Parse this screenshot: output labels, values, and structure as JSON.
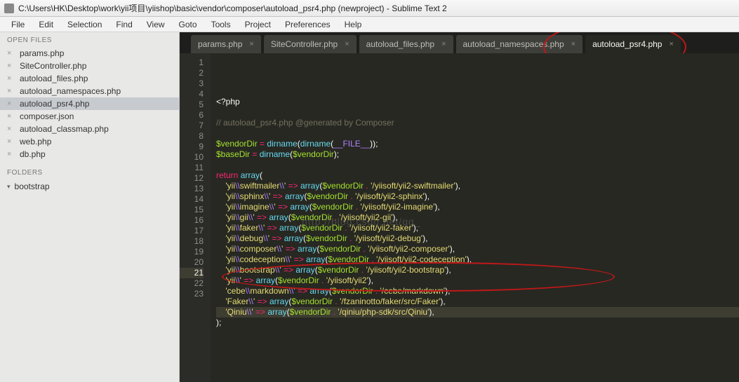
{
  "window": {
    "title": "C:\\Users\\HK\\Desktop\\work\\yii项目\\yiishop\\basic\\vendor\\composer\\autoload_psr4.php (newproject) - Sublime Text 2"
  },
  "menu": {
    "items": [
      "File",
      "Edit",
      "Selection",
      "Find",
      "View",
      "Goto",
      "Tools",
      "Project",
      "Preferences",
      "Help"
    ]
  },
  "sidebar": {
    "open_files_header": "OPEN FILES",
    "open_files": [
      {
        "label": "params.php",
        "active": false
      },
      {
        "label": "SiteController.php",
        "active": false
      },
      {
        "label": "autoload_files.php",
        "active": false
      },
      {
        "label": "autoload_namespaces.php",
        "active": false
      },
      {
        "label": "autoload_psr4.php",
        "active": true
      },
      {
        "label": "composer.json",
        "active": false
      },
      {
        "label": "autoload_classmap.php",
        "active": false
      },
      {
        "label": "web.php",
        "active": false
      },
      {
        "label": "db.php",
        "active": false
      }
    ],
    "folders_header": "FOLDERS",
    "folders": [
      {
        "label": "bootstrap"
      }
    ]
  },
  "tabs": [
    {
      "label": "params.php",
      "active": false,
      "highlight": false
    },
    {
      "label": "SiteController.php",
      "active": false,
      "highlight": false
    },
    {
      "label": "autoload_files.php",
      "active": false,
      "highlight": false
    },
    {
      "label": "autoload_namespaces.php",
      "active": false,
      "highlight": false
    },
    {
      "label": "autoload_psr4.php",
      "active": true,
      "highlight": true
    }
  ],
  "code": {
    "lang": "php",
    "comment": "// autoload_psr4.php @generated by Composer",
    "vendor_var": "$vendorDir",
    "base_var": "$baseDir",
    "dirname_fn": "dirname",
    "file_const": "__FILE__",
    "return_kw": "return",
    "array_kw": "array",
    "open_tag": "<?php",
    "entries": [
      {
        "ns": "yii\\\\swiftmailer\\\\",
        "path": "/yiisoft/yii2-swiftmailer"
      },
      {
        "ns": "yii\\\\sphinx\\\\",
        "path": "/yiisoft/yii2-sphinx"
      },
      {
        "ns": "yii\\\\imagine\\\\",
        "path": "/yiisoft/yii2-imagine"
      },
      {
        "ns": "yii\\\\gii\\\\",
        "path": "/yiisoft/yii2-gii"
      },
      {
        "ns": "yii\\\\faker\\\\",
        "path": "/yiisoft/yii2-faker"
      },
      {
        "ns": "yii\\\\debug\\\\",
        "path": "/yiisoft/yii2-debug"
      },
      {
        "ns": "yii\\\\composer\\\\",
        "path": "/yiisoft/yii2-composer"
      },
      {
        "ns": "yii\\\\codeception\\\\",
        "path": "/yiisoft/yii2-codeception"
      },
      {
        "ns": "yii\\\\bootstrap\\\\",
        "path": "/yiisoft/yii2-bootstrap"
      },
      {
        "ns": "yii\\\\",
        "path": "/yiisoft/yii2"
      },
      {
        "ns": "cebe\\\\markdown\\\\",
        "path": "/cebe/markdown"
      },
      {
        "ns": "Faker\\\\",
        "path": "/fzaninotto/faker/src/Faker"
      },
      {
        "ns": "Qiniu\\\\",
        "path": "/qiniu/php-sdk/src/Qiniu"
      }
    ],
    "total_lines": 23,
    "current_line": 21
  },
  "watermark": "http://blog.csdn.net/qq_"
}
